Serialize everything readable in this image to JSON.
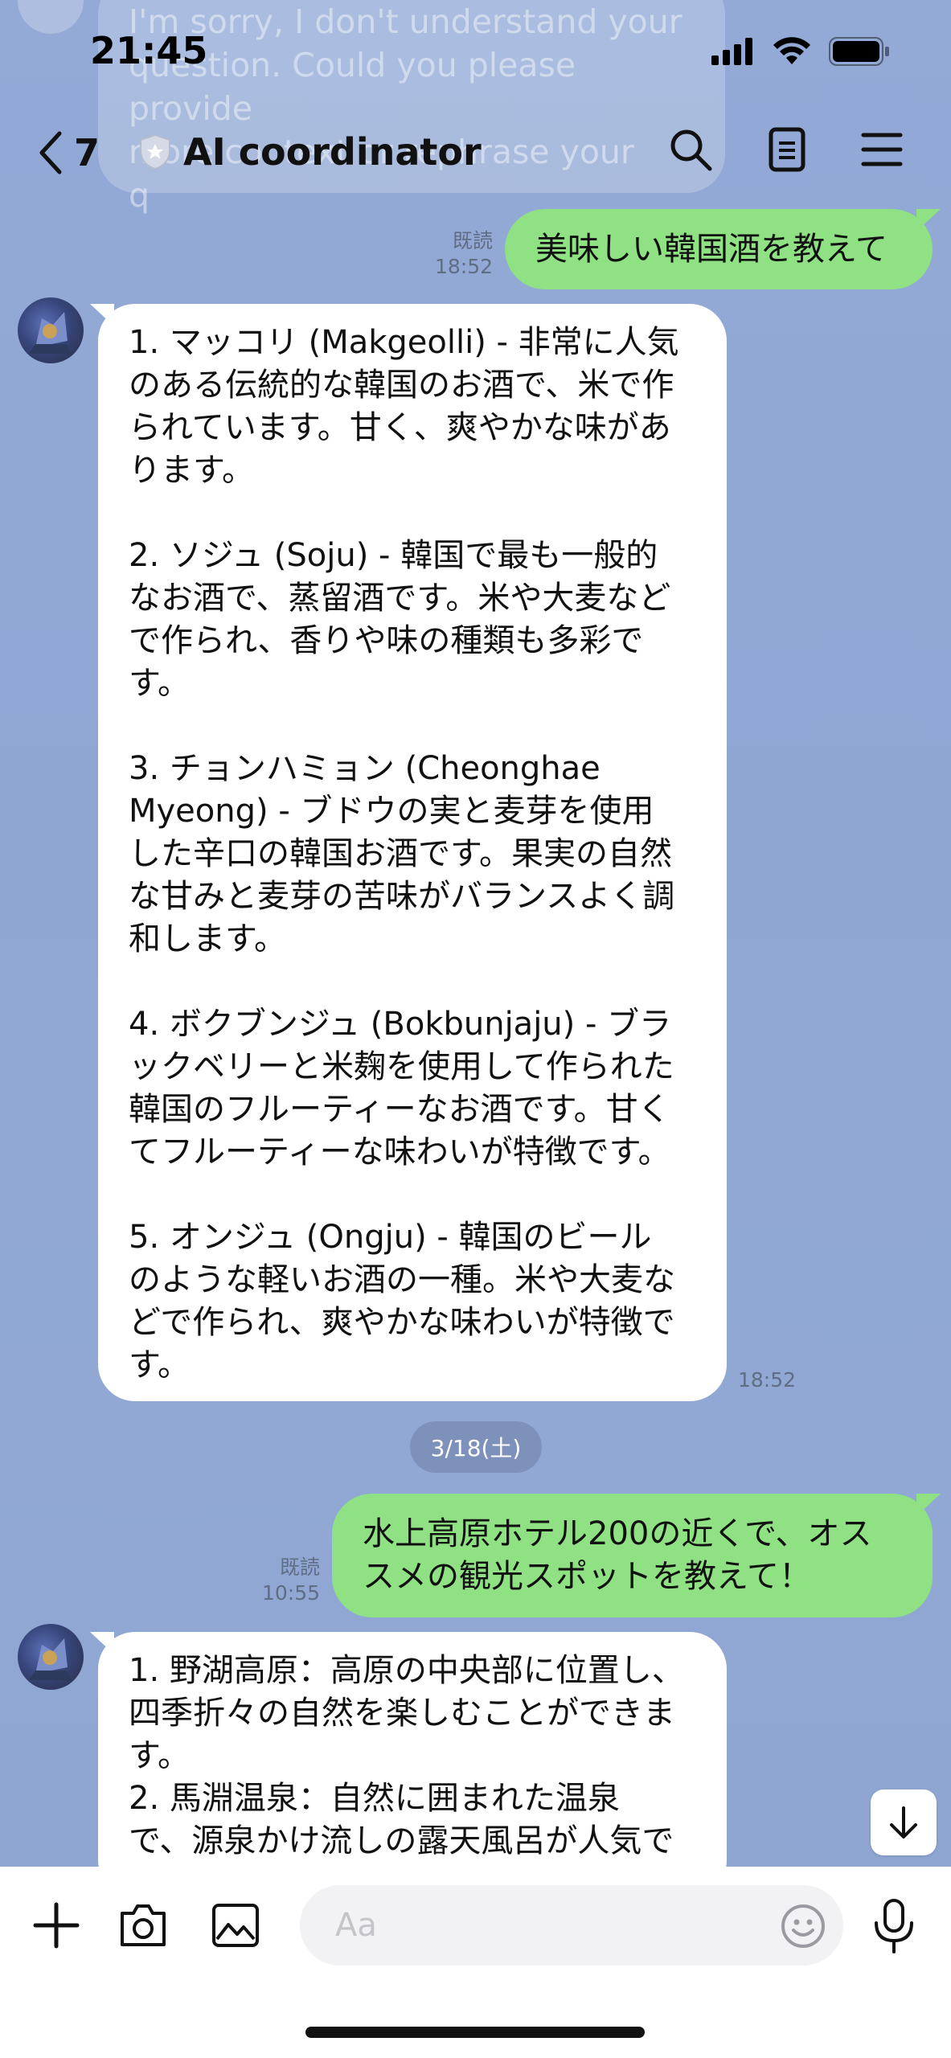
{
  "status_bar": {
    "time": "21:45"
  },
  "header": {
    "back_count": "7",
    "title": "AI coordinator"
  },
  "ghost_message": {
    "text": "I'm sorry, I don't understand your\nquestion. Could you please provide\nmore context or rephrase your\nq"
  },
  "messages": [
    {
      "read_label": "既読",
      "time": "18:52",
      "text": "美味しい韓国酒を教えて"
    },
    {
      "time": "18:52",
      "text": "1. マッコリ (Makgeolli) - 非常に人気\nのある伝統的な韓国のお酒で、米で作\nられています。甘く、爽やかな味があ\nります。\n\n2. ソジュ (Soju) - 韓国で最も一般的\nなお酒で、蒸留酒です。米や大麦など\nで作られ、香りや味の種類も多彩で\nす。\n\n3. チョンハミョン (Cheonghae\nMyeong) - ブドウの実と麦芽を使用\nした辛口の韓国お酒です。果実の自然\nな甘みと麦芽の苦味がバランスよく調\n和します。\n\n4. ボクブンジュ (Bokbunjaju) - ブラ\nックベリーと米麹を使用して作られた\n韓国のフルーティーなお酒です。甘く\nてフルーティーな味わいが特徴です。\n\n5. オンジュ (Ongju) - 韓国のビール\nのような軽いお酒の一種。米や大麦な\nどで作られ、爽やかな味わいが特徴で\nす。"
    },
    {
      "date": "3/18(土)"
    },
    {
      "read_label": "既読",
      "time": "10:55",
      "text": "水上高原ホテル200の近くで、オス\nスメの観光スポットを教えて！"
    },
    {
      "text": "1. 野湖高原：高原の中央部に位置し、\n四季折々の自然を楽しむことができま\nす。\n2. 馬淵温泉：自然に囲まれた温泉\nで、源泉かけ流しの露天風呂が人気で"
    }
  ],
  "input": {
    "placeholder": "Aa",
    "value": ""
  },
  "colors": {
    "background": "#93a9d6",
    "outgoing_bubble": "#8fe183",
    "incoming_bubble": "#ffffff"
  },
  "icons": [
    "back-chevron-icon",
    "official-shield-icon",
    "search-icon",
    "notes-icon",
    "menu-icon",
    "scroll-down-icon",
    "plus-icon",
    "camera-icon",
    "image-icon",
    "emoji-icon",
    "mic-icon"
  ]
}
